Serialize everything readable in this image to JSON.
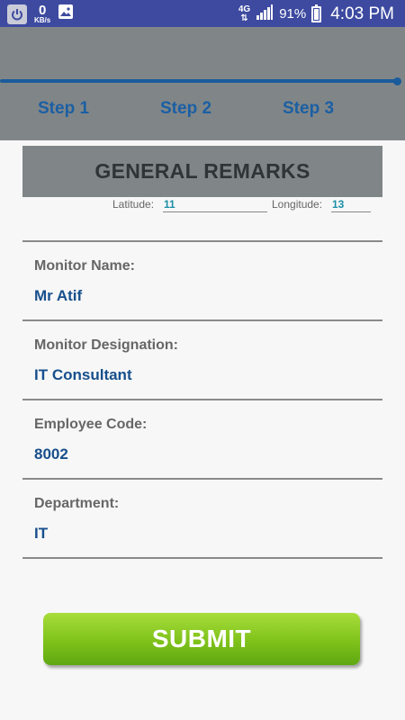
{
  "status_bar": {
    "data_rate": "0",
    "data_unit": "KB/s",
    "network": "4G",
    "battery": "91%",
    "time": "4:03 PM"
  },
  "stepper": {
    "steps": [
      "Step 1",
      "Step 2",
      "Step 3"
    ],
    "colors": {
      "accent": "#1b5fa4",
      "header_bg": "#808688"
    }
  },
  "section": {
    "title": "GENERAL REMARKS"
  },
  "location": {
    "latitude_label": "Latitude:",
    "latitude_value": "11",
    "longitude_label": "Longitude:",
    "longitude_value": "13"
  },
  "fields": [
    {
      "label": "Monitor Name:",
      "value": "Mr Atif"
    },
    {
      "label": "Monitor Designation:",
      "value": "IT Consultant"
    },
    {
      "label": "Employee Code:",
      "value": "8002"
    },
    {
      "label": "Department:",
      "value": "IT"
    }
  ],
  "actions": {
    "submit_label": "SUBMIT",
    "submit_color": "#7fc21a"
  }
}
